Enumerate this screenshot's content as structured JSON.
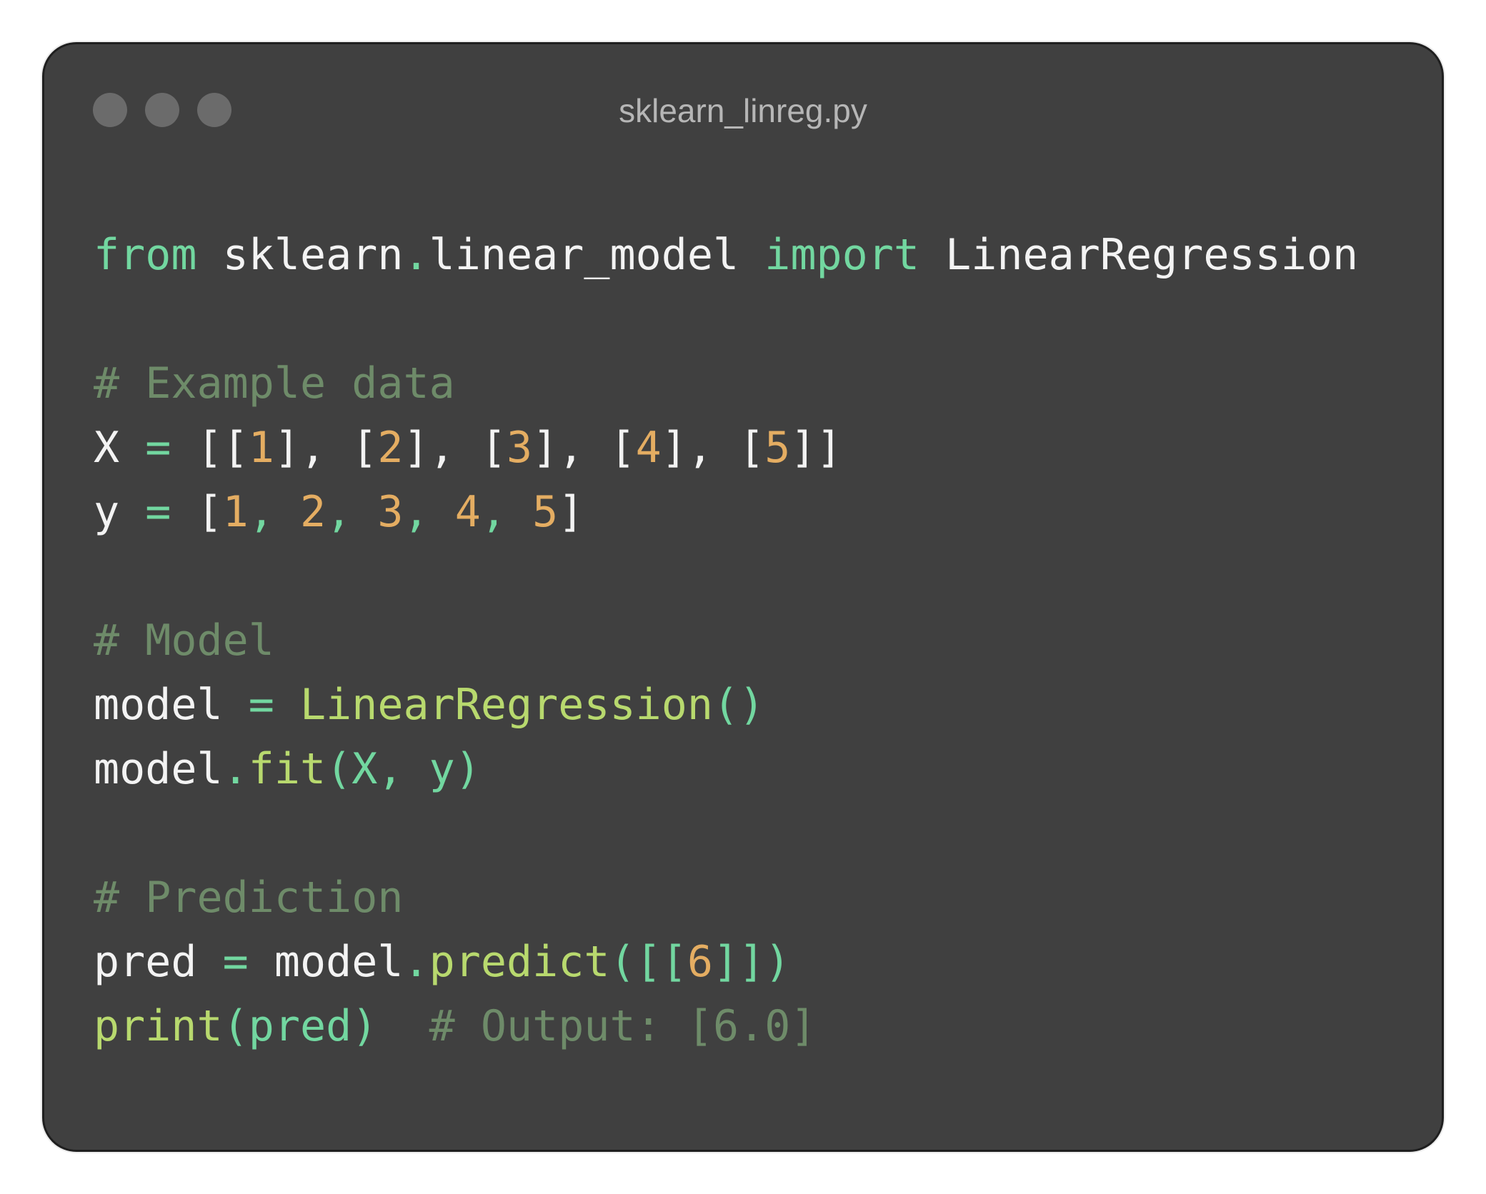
{
  "window": {
    "title": "sklearn_linreg.py",
    "controls": [
      "close-dot",
      "minimize-dot",
      "maximize-dot"
    ]
  },
  "code": [
    [
      {
        "text": "from",
        "type": "kw"
      },
      {
        "text": " sklearn",
        "type": "plain"
      },
      {
        "text": ".",
        "type": "punc"
      },
      {
        "text": "linear_model ",
        "type": "plain"
      },
      {
        "text": "import",
        "type": "kw"
      },
      {
        "text": " LinearRegression",
        "type": "plain"
      }
    ],
    [],
    [
      {
        "text": "# Example data",
        "type": "comment"
      }
    ],
    [
      {
        "text": "X ",
        "type": "plain"
      },
      {
        "text": "=",
        "type": "op"
      },
      {
        "text": " [[",
        "type": "plain"
      },
      {
        "text": "1",
        "type": "num"
      },
      {
        "text": "], ",
        "type": "plain"
      },
      {
        "text": "[",
        "type": "plain"
      },
      {
        "text": "2",
        "type": "num"
      },
      {
        "text": "], ",
        "type": "plain"
      },
      {
        "text": "[",
        "type": "plain"
      },
      {
        "text": "3",
        "type": "num"
      },
      {
        "text": "], ",
        "type": "plain"
      },
      {
        "text": "[",
        "type": "plain"
      },
      {
        "text": "4",
        "type": "num"
      },
      {
        "text": "], ",
        "type": "plain"
      },
      {
        "text": "[",
        "type": "plain"
      },
      {
        "text": "5",
        "type": "num"
      },
      {
        "text": "]]",
        "type": "plain"
      }
    ],
    [
      {
        "text": "y ",
        "type": "plain"
      },
      {
        "text": "=",
        "type": "op"
      },
      {
        "text": " [",
        "type": "plain"
      },
      {
        "text": "1",
        "type": "num"
      },
      {
        "text": ", ",
        "type": "punc"
      },
      {
        "text": "2",
        "type": "num"
      },
      {
        "text": ", ",
        "type": "punc"
      },
      {
        "text": "3",
        "type": "num"
      },
      {
        "text": ", ",
        "type": "punc"
      },
      {
        "text": "4",
        "type": "num"
      },
      {
        "text": ", ",
        "type": "punc"
      },
      {
        "text": "5",
        "type": "num"
      },
      {
        "text": "]",
        "type": "plain"
      }
    ],
    [],
    [
      {
        "text": "# Model",
        "type": "comment"
      }
    ],
    [
      {
        "text": "model ",
        "type": "plain"
      },
      {
        "text": "=",
        "type": "op"
      },
      {
        "text": " LinearRegression",
        "type": "cls"
      },
      {
        "text": "()",
        "type": "punc"
      }
    ],
    [
      {
        "text": "model",
        "type": "plain"
      },
      {
        "text": ".",
        "type": "punc"
      },
      {
        "text": "fit",
        "type": "fn"
      },
      {
        "text": "(X, y)",
        "type": "punc"
      }
    ],
    [],
    [
      {
        "text": "# Prediction",
        "type": "comment"
      }
    ],
    [
      {
        "text": "pred ",
        "type": "plain"
      },
      {
        "text": "=",
        "type": "op"
      },
      {
        "text": " model",
        "type": "plain"
      },
      {
        "text": ".",
        "type": "punc"
      },
      {
        "text": "predict",
        "type": "fn"
      },
      {
        "text": "([[",
        "type": "punc"
      },
      {
        "text": "6",
        "type": "num"
      },
      {
        "text": "]])",
        "type": "punc"
      }
    ],
    [
      {
        "text": "print",
        "type": "fn"
      },
      {
        "text": "(pred)",
        "type": "punc"
      },
      {
        "text": "  # Output: [6.0]",
        "type": "comment"
      }
    ]
  ],
  "colors": {
    "background": "#404040",
    "keyword": "#72d7a0",
    "plain": "#f3f3f3",
    "number": "#e4ad62",
    "function": "#b8d96e",
    "comment": "#6e8b69",
    "title": "#b6b6b6"
  }
}
